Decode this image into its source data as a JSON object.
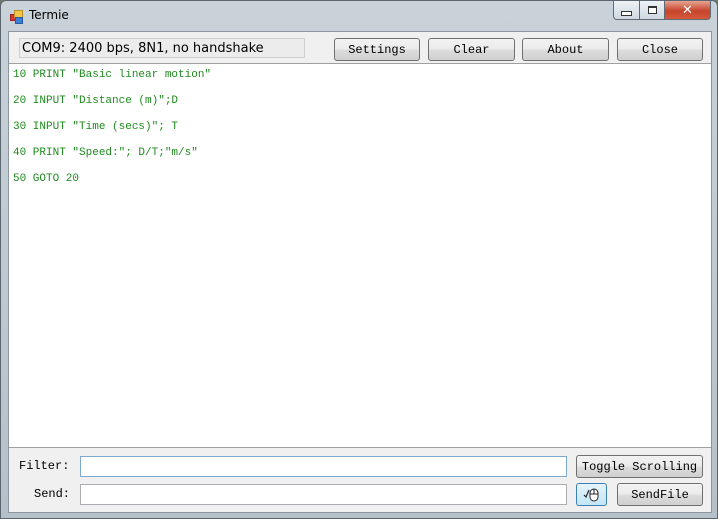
{
  "window": {
    "title": "Termie",
    "caption_buttons": {
      "minimize": "minimize",
      "maximize": "maximize",
      "close": "close"
    }
  },
  "toolbar": {
    "status": "COM9: 2400 bps, 8N1, no handshake",
    "settings_label": "Settings",
    "clear_label": "Clear",
    "about_label": "About",
    "close_label": "Close"
  },
  "terminal": {
    "text_color": "#1f8a1f",
    "lines": [
      "10 PRINT \"Basic linear motion\"",
      "20 INPUT \"Distance (m)\";D",
      "30 INPUT \"Time (secs)\"; T",
      "40 PRINT \"Speed:\"; D/T;\"m/s\"",
      "50 GOTO 20"
    ]
  },
  "bottom": {
    "filter_label": "Filter:",
    "filter_value": "",
    "send_label": "Send:",
    "send_value": "",
    "toggle_scrolling_label": "Toggle Scrolling",
    "mouse_icon": "mouse-icon",
    "sendfile_label": "SendFile"
  }
}
